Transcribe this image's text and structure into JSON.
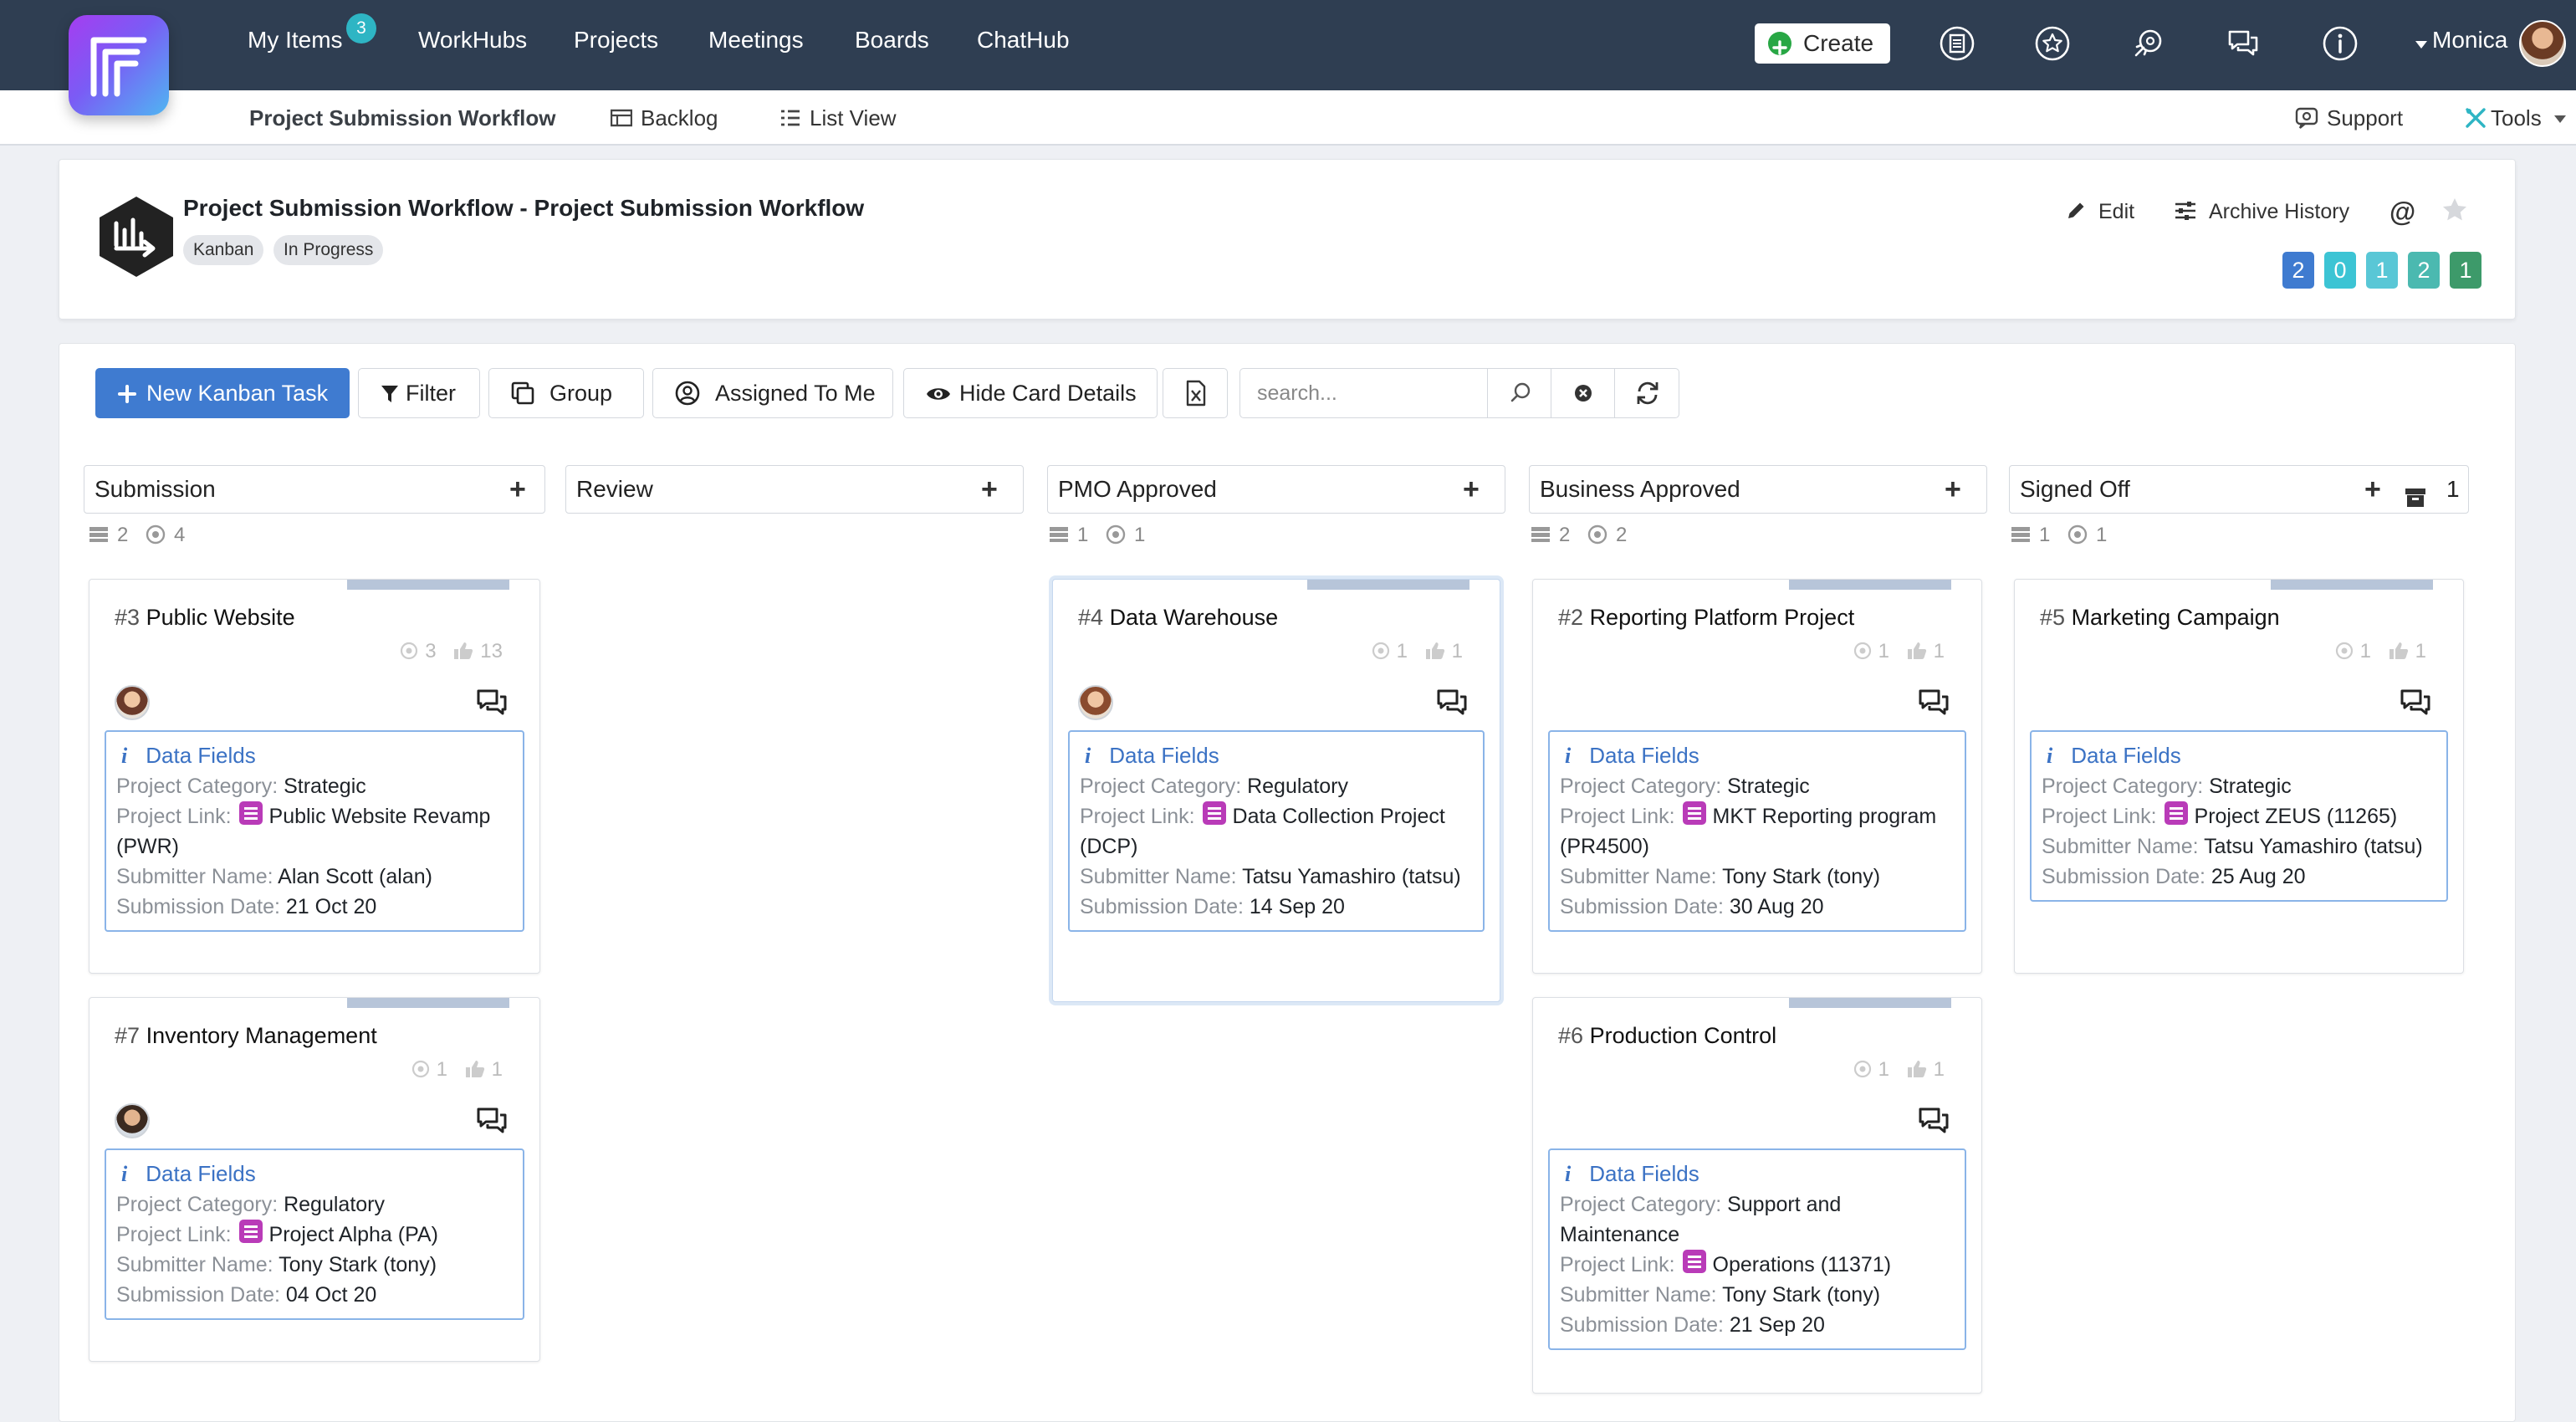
{
  "nav": {
    "items": [
      "My Items",
      "WorkHubs",
      "Projects",
      "Meetings",
      "Boards",
      "ChatHub"
    ],
    "my_items_badge": "3",
    "create_label": "Create",
    "user_name": "Monica",
    "icons": [
      "newspaper-icon",
      "star-badge-icon",
      "rocket-icon",
      "chat-bubbles-icon",
      "info-icon"
    ]
  },
  "subnav": {
    "workflow": "Project Submission Workflow",
    "backlog": "Backlog",
    "list_view": "List View",
    "support": "Support",
    "tools": "Tools"
  },
  "header": {
    "title": "Project Submission Workflow - Project Submission Workflow",
    "tags": [
      "Kanban",
      "In Progress"
    ],
    "edit": "Edit",
    "archive_history": "Archive History",
    "counts": [
      {
        "value": "2",
        "color": "#3f7bd0"
      },
      {
        "value": "0",
        "color": "#3cc4d4"
      },
      {
        "value": "1",
        "color": "#59c7d6"
      },
      {
        "value": "2",
        "color": "#4bb9b0"
      },
      {
        "value": "1",
        "color": "#3d9a6a"
      }
    ]
  },
  "toolbar": {
    "new_task": "New Kanban Task",
    "filter": "Filter",
    "group": "Group",
    "assigned": "Assigned To Me",
    "hide_details": "Hide Card Details",
    "search_placeholder": "search..."
  },
  "columns": [
    {
      "name": "Submission",
      "tasks": "2",
      "items": "4"
    },
    {
      "name": "Review"
    },
    {
      "name": "PMO Approved",
      "tasks": "1",
      "items": "1"
    },
    {
      "name": "Business Approved",
      "tasks": "2",
      "items": "2"
    },
    {
      "name": "Signed Off",
      "tasks": "1",
      "items": "1",
      "archived": "1"
    }
  ],
  "labels": {
    "data_fields": "Data Fields",
    "category": "Project Category:",
    "link": "Project Link:",
    "submitter": "Submitter Name:",
    "date": "Submission Date:"
  },
  "cards": [
    {
      "num": "#3",
      "title": "Public Website",
      "s1": "3",
      "s2": "13",
      "category": "Strategic",
      "link": "Public Website Revamp (PWR)",
      "submitter": "Alan Scott (alan)",
      "date": "21 Oct 20"
    },
    {
      "num": "#7",
      "title": "Inventory Management",
      "s1": "1",
      "s2": "1",
      "category": "Regulatory",
      "link": "Project Alpha (PA)",
      "submitter": "Tony Stark (tony)",
      "date": "04 Oct 20"
    },
    {
      "num": "#4",
      "title": "Data Warehouse",
      "s1": "1",
      "s2": "1",
      "category": "Regulatory",
      "link": "Data Collection Project (DCP)",
      "submitter": "Tatsu Yamashiro (tatsu)",
      "date": "14 Sep 20"
    },
    {
      "num": "#2",
      "title": "Reporting Platform Project",
      "s1": "1",
      "s2": "1",
      "category": "Strategic",
      "link": "MKT Reporting program (PR4500)",
      "submitter": "Tony Stark (tony)",
      "date": "30 Aug 20"
    },
    {
      "num": "#6",
      "title": "Production Control",
      "s1": "1",
      "s2": "1",
      "category": "Support and Maintenance",
      "link": "Operations (11371)",
      "submitter": "Tony Stark (tony)",
      "date": "21 Sep 20"
    },
    {
      "num": "#5",
      "title": "Marketing Campaign",
      "s1": "1",
      "s2": "1",
      "category": "Strategic",
      "link": "Project ZEUS (11265)",
      "submitter": "Tatsu Yamashiro (tatsu)",
      "date": "25 Aug 20"
    }
  ]
}
